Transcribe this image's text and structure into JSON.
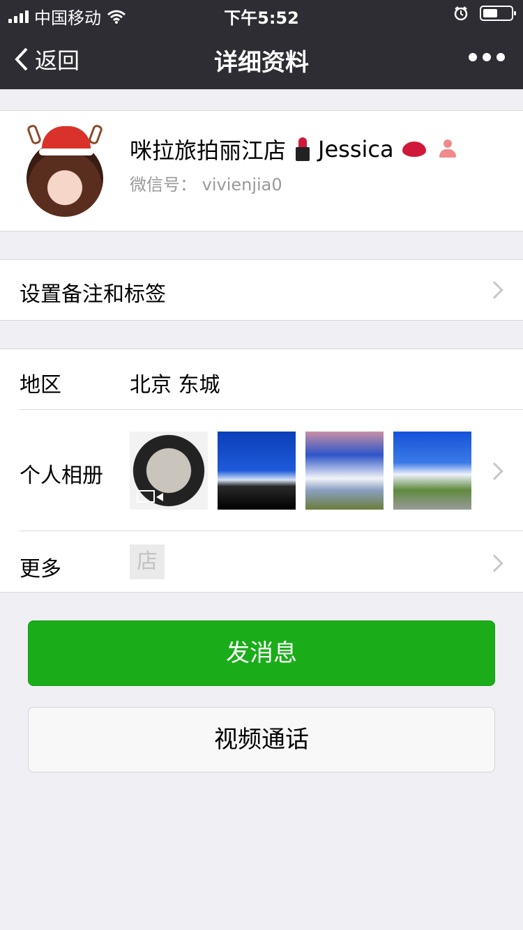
{
  "status_bar": {
    "carrier": "中国移动",
    "time": "下午5:52"
  },
  "nav": {
    "back_label": "返回",
    "title": "详细资料"
  },
  "profile": {
    "name": "咪拉旅拍丽江店",
    "name_suffix": "Jessica",
    "wechat_id": "微信号： vivienjia0"
  },
  "remark": {
    "label": "设置备注和标签"
  },
  "info": {
    "region_label": "地区",
    "region_value": "北京 东城",
    "album_label": "个人相册",
    "more_label": "更多",
    "shop_icon_text": "店"
  },
  "buttons": {
    "send_message": "发消息",
    "video_call": "视频通话"
  },
  "colors": {
    "nav_bg": "#2e2d33",
    "primary_green": "#1aad19",
    "page_bg": "#efeff4"
  }
}
